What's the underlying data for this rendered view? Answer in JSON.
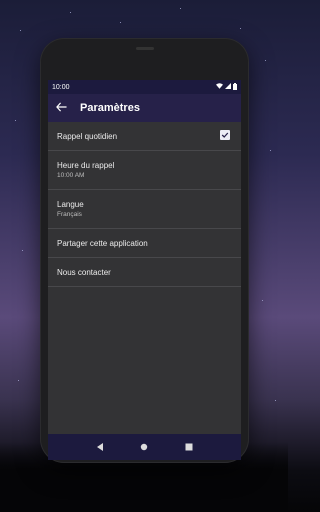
{
  "status_bar": {
    "time": "10:00"
  },
  "app_bar": {
    "title": "Paramètres"
  },
  "settings": {
    "daily_reminder": {
      "label": "Rappel quotidien",
      "checked": true
    },
    "reminder_time": {
      "label": "Heure du rappel",
      "value": "10:00 AM"
    },
    "language": {
      "label": "Langue",
      "value": "Français"
    },
    "share": {
      "label": "Partager cette application"
    },
    "contact": {
      "label": "Nous contacter"
    }
  },
  "colors": {
    "status_bar": "#1c1a3e",
    "app_bar": "#262149",
    "screen_bg": "#333335"
  },
  "icons": [
    "back-arrow-icon",
    "wifi-icon",
    "signal-icon",
    "battery-icon",
    "checkbox-checked-icon",
    "nav-back-icon",
    "nav-home-icon",
    "nav-recents-icon"
  ]
}
